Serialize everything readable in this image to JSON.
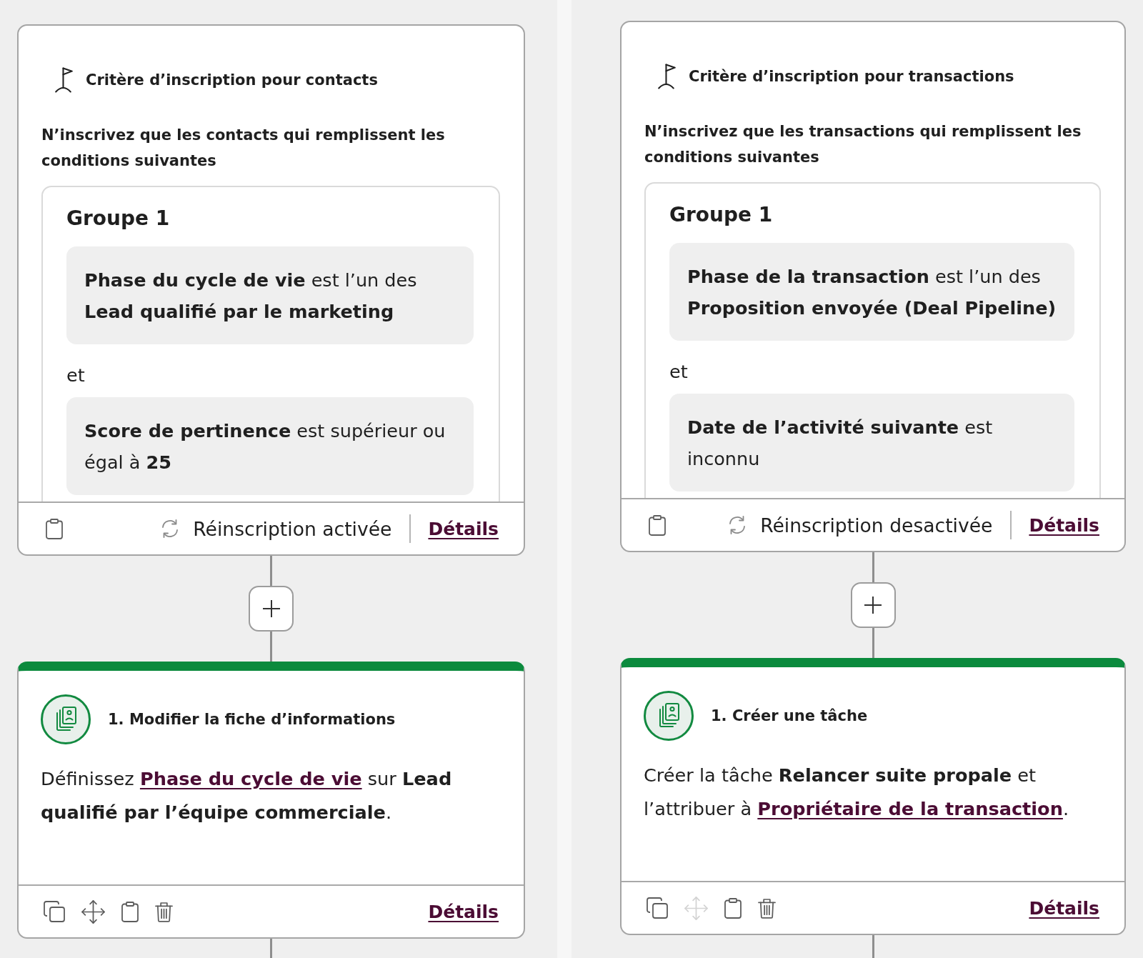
{
  "panels": [
    {
      "trigger": {
        "title": "Critère d’inscription pour contacts",
        "description": "N’inscrivez que les contacts qui remplissent les conditions suivantes",
        "group": {
          "title": "Groupe 1",
          "items": [
            {
              "kind": "condition",
              "text": "**Phase du cycle de vie** est l’un des **Lead qualifié par le marketing**"
            },
            {
              "kind": "operator",
              "text": "et"
            },
            {
              "kind": "condition",
              "text": "**Score de pertinence** est supérieur ou égal à **25**"
            }
          ]
        },
        "reenrollment": "Réinscription activée",
        "details": "Détails"
      },
      "action": {
        "title": "1. Modifier la fiche d’informations",
        "body": [
          {
            "kind": "text",
            "text": "Définissez "
          },
          {
            "kind": "link",
            "text": "Phase du cycle de vie"
          },
          {
            "kind": "text",
            "text": " sur **Lead qualifié par l’équipe commerciale**."
          }
        ],
        "tools": [
          {
            "kind": "copy",
            "disabled": false
          },
          {
            "kind": "move",
            "disabled": false
          },
          {
            "kind": "clipboard",
            "disabled": false
          },
          {
            "kind": "delete",
            "disabled": false
          }
        ],
        "details": "Détails"
      }
    },
    {
      "trigger": {
        "title": "Critère d’inscription pour transactions",
        "description": "N’inscrivez que les transactions qui remplissent les conditions suivantes",
        "group": {
          "title": "Groupe 1",
          "items": [
            {
              "kind": "condition",
              "text": "**Phase de la transaction** est l’un des **Proposition envoyée (Deal Pipeline)**"
            },
            {
              "kind": "operator",
              "text": "et"
            },
            {
              "kind": "condition",
              "text": "**Date de l’activité suivante** est inconnu"
            }
          ]
        },
        "reenrollment": "Réinscription desactivée",
        "details": "Détails"
      },
      "action": {
        "title": "1. Créer une tâche",
        "body": [
          {
            "kind": "text",
            "text": "Créer la tâche **Relancer suite propale** et l’attribuer à "
          },
          {
            "kind": "link",
            "text": "Propriétaire de la transaction"
          },
          {
            "kind": "text",
            "text": "."
          }
        ],
        "tools": [
          {
            "kind": "copy",
            "disabled": false
          },
          {
            "kind": "move",
            "disabled": true
          },
          {
            "kind": "clipboard",
            "disabled": false
          },
          {
            "kind": "delete",
            "disabled": false
          }
        ],
        "details": "Détails"
      }
    }
  ]
}
